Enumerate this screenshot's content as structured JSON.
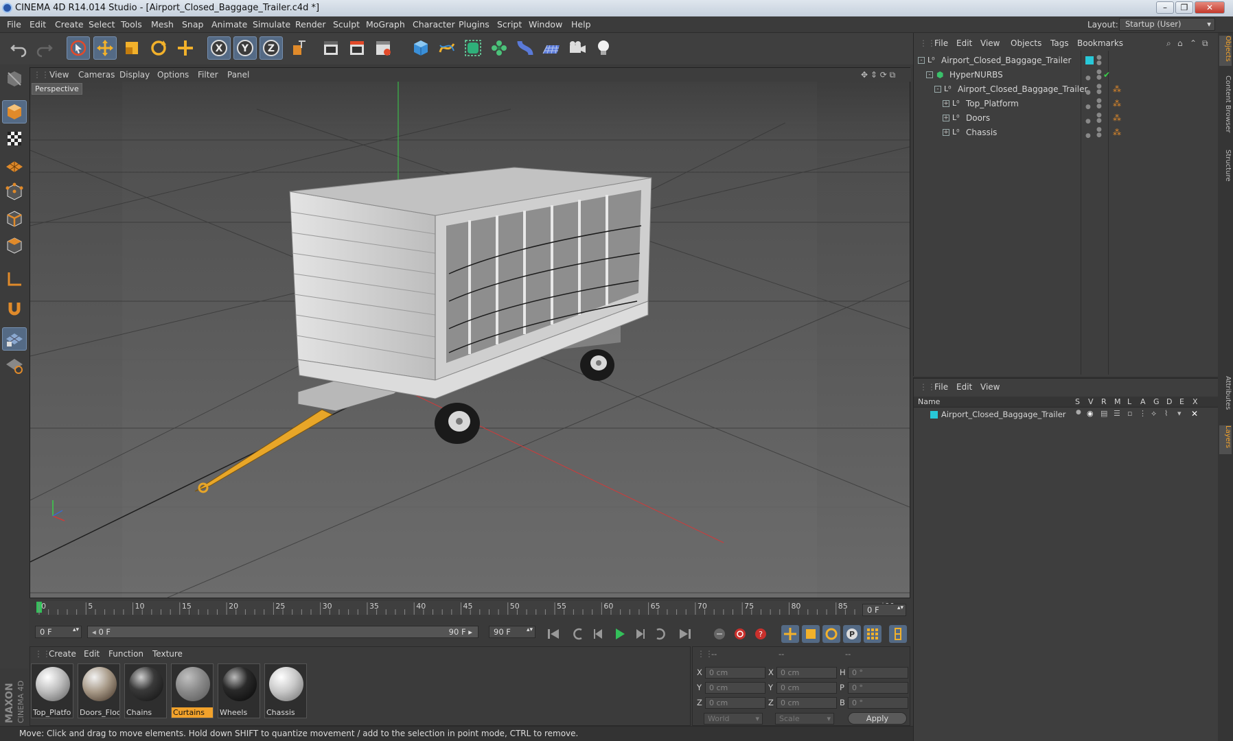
{
  "window": {
    "title": "CINEMA 4D R14.014 Studio - [Airport_Closed_Baggage_Trailer.c4d *]"
  },
  "menubar": {
    "items": [
      "File",
      "Edit",
      "Create",
      "Select",
      "Tools",
      "Mesh",
      "Snap",
      "Animate",
      "Simulate",
      "Render",
      "Sculpt",
      "MoGraph",
      "Character",
      "Plugins",
      "Script",
      "Window",
      "Help"
    ],
    "layout_label": "Layout:",
    "layout_value": "Startup (User)"
  },
  "viewport": {
    "menu": [
      "View",
      "Cameras",
      "Display",
      "Options",
      "Filter",
      "Panel"
    ],
    "camera_label": "Perspective"
  },
  "timeline": {
    "ticks": [
      "0",
      "5",
      "10",
      "15",
      "20",
      "25",
      "30",
      "35",
      "40",
      "45",
      "50",
      "55",
      "60",
      "65",
      "70",
      "75",
      "80",
      "85",
      "90"
    ],
    "current_frame": "0 F",
    "start_frame": "0 F",
    "range_start": "0 F",
    "range_end": "90 F",
    "end_frame": "90 F"
  },
  "materials": {
    "menu": [
      "Create",
      "Edit",
      "Function",
      "Texture"
    ],
    "items": [
      {
        "name": "Top_Platfo"
      },
      {
        "name": "Doors_Floc"
      },
      {
        "name": "Chains"
      },
      {
        "name": "Curtains"
      },
      {
        "name": "Wheels"
      },
      {
        "name": "Chassis"
      }
    ],
    "selected": "Curtains"
  },
  "coordinates": {
    "header": [
      "--",
      "--",
      "--"
    ],
    "rows": [
      {
        "l1": "X",
        "v1": "0 cm",
        "l2": "X",
        "v2": "0 cm",
        "l3": "H",
        "v3": "0 °"
      },
      {
        "l1": "Y",
        "v1": "0 cm",
        "l2": "Y",
        "v2": "0 cm",
        "l3": "P",
        "v3": "0 °"
      },
      {
        "l1": "Z",
        "v1": "0 cm",
        "l2": "Z",
        "v2": "0 cm",
        "l3": "B",
        "v3": "0 °"
      }
    ],
    "mode_world": "World",
    "mode_scale": "Scale",
    "apply": "Apply"
  },
  "objects": {
    "menu": [
      "File",
      "Edit",
      "View",
      "Objects",
      "Tags",
      "Bookmarks"
    ],
    "tree": [
      {
        "label": "Airport_Closed_Baggage_Trailer"
      },
      {
        "label": "HyperNURBS"
      },
      {
        "label": "Airport_Closed_Baggage_Trailer"
      },
      {
        "label": "Top_Platform"
      },
      {
        "label": "Doors"
      },
      {
        "label": "Chassis"
      }
    ]
  },
  "layers": {
    "menu": [
      "File",
      "Edit",
      "View"
    ],
    "columns": [
      "Name",
      "S",
      "V",
      "R",
      "M",
      "L",
      "A",
      "G",
      "D",
      "E",
      "X"
    ],
    "rows": [
      {
        "name": "Airport_Closed_Baggage_Trailer"
      }
    ]
  },
  "side_tabs": [
    "Objects",
    "Content Browser",
    "Structure",
    "Attributes",
    "Layers"
  ],
  "status": {
    "text": "Move: Click and drag to move elements. Hold down SHIFT to quantize movement / add to the selection in point mode, CTRL to remove."
  },
  "brand": {
    "line1": "MAXON",
    "line2": "CINEMA 4D"
  },
  "colors": {
    "accent": "#546a85",
    "material_selected": "#f2a22b",
    "layer_color": "#28c8d8"
  }
}
